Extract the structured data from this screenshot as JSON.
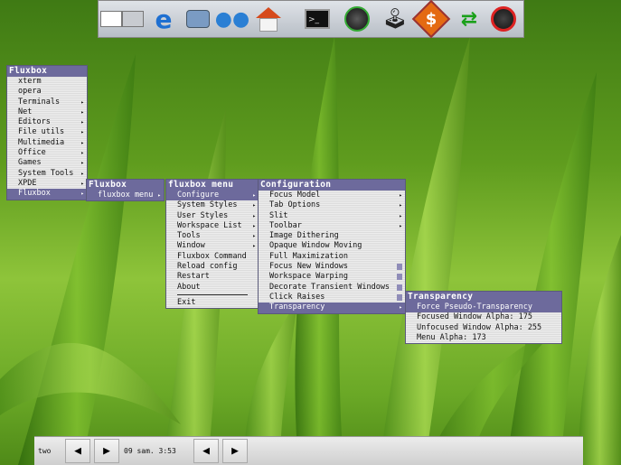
{
  "colors": {
    "menu_title_bg": "#6d6a9c",
    "menu_bg": "#e6e6e6",
    "check": "#8f8cb8"
  },
  "dock": {
    "icons": [
      "workspace-pager-icon",
      "internet-explorer-icon",
      "network-computer-icon",
      "users-icon",
      "home-icon",
      "terminal-icon",
      "media-player-icon",
      "joystick-icon",
      "money-icon",
      "sync-arrows-icon",
      "shutdown-icon"
    ]
  },
  "root_menu": {
    "title": "Fluxbox",
    "items": [
      {
        "label": "xterm",
        "arrow": false
      },
      {
        "label": "opera",
        "arrow": false
      },
      {
        "label": "Terminals",
        "arrow": true
      },
      {
        "label": "Net",
        "arrow": true
      },
      {
        "label": "Editors",
        "arrow": true
      },
      {
        "label": "File utils",
        "arrow": true
      },
      {
        "label": "Multimedia",
        "arrow": true
      },
      {
        "label": "Office",
        "arrow": true
      },
      {
        "label": "Games",
        "arrow": true
      },
      {
        "label": "System Tools",
        "arrow": true
      },
      {
        "label": "XPDE",
        "arrow": true
      },
      {
        "label": "Fluxbox",
        "arrow": true,
        "selected": true
      }
    ]
  },
  "fluxbox_sub": {
    "title": "Fluxbox",
    "items": [
      {
        "label": "fluxbox menu",
        "arrow": true,
        "selected": true
      }
    ]
  },
  "fluxbox_menu": {
    "title": "fluxbox menu",
    "items": [
      {
        "label": "Configure",
        "arrow": true,
        "selected": true
      },
      {
        "label": "System Styles",
        "arrow": true
      },
      {
        "label": "User Styles",
        "arrow": true
      },
      {
        "label": "Workspace List",
        "arrow": true
      },
      {
        "label": "Tools",
        "arrow": true
      },
      {
        "label": "Window",
        "arrow": true
      },
      {
        "label": "Fluxbox Command",
        "arrow": false
      },
      {
        "label": "Reload config",
        "arrow": false
      },
      {
        "label": "Restart",
        "arrow": false
      },
      {
        "label": "About",
        "arrow": false
      },
      {
        "separator": true
      },
      {
        "label": "Exit",
        "arrow": false
      }
    ]
  },
  "config_menu": {
    "title": "Configuration",
    "items": [
      {
        "label": "Focus Model",
        "arrow": true
      },
      {
        "label": "Tab Options",
        "arrow": true
      },
      {
        "label": "Slit",
        "arrow": true
      },
      {
        "label": "Toolbar",
        "arrow": true
      },
      {
        "label": "Image Dithering",
        "check": false
      },
      {
        "label": "Opaque Window Moving",
        "check": false
      },
      {
        "label": "Full Maximization",
        "check": false
      },
      {
        "label": "Focus New Windows",
        "check": true
      },
      {
        "label": "Workspace Warping",
        "check": true
      },
      {
        "label": "Decorate Transient Windows",
        "check": true
      },
      {
        "label": "Click Raises",
        "check": true
      },
      {
        "label": "Transparency",
        "arrow": true,
        "selected": true
      }
    ]
  },
  "transparency_menu": {
    "title": "Transparency",
    "items": [
      {
        "label": "Force Pseudo-Transparency",
        "selected": true
      },
      {
        "label": "Focused Window Alpha: 175"
      },
      {
        "label": "Unfocused Window Alpha: 255"
      },
      {
        "label": "Menu Alpha: 173"
      }
    ]
  },
  "toolbar": {
    "workspace": "two",
    "clock": "09 sam. 3:53",
    "prev_glyph": "◀",
    "next_glyph": "▶"
  }
}
